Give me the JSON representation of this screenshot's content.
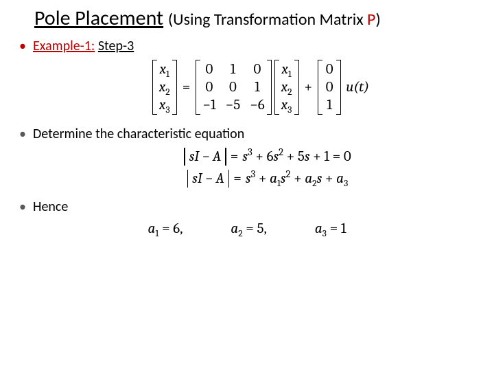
{
  "title": {
    "main": "Pole Placement",
    "sub_open": "(Using Transformation Matrix ",
    "p": "P",
    "sub_close": ")"
  },
  "bullet1": {
    "example": "Example-1:",
    "step": "Step-3"
  },
  "state_equation": {
    "x_vec": [
      "x",
      "x",
      "x"
    ],
    "x_sub": [
      "1",
      "2",
      "3"
    ],
    "A": [
      [
        "0",
        "1",
        "0"
      ],
      [
        "0",
        "0",
        "1"
      ],
      [
        "−1",
        "−5",
        "−6"
      ]
    ],
    "B": [
      "0",
      "0",
      "1"
    ],
    "eq": "=",
    "plus": "+",
    "u": "u(t)"
  },
  "bullet2": "Determine the characteristic equation",
  "char_eq": {
    "lhs_inner": "sI − A",
    "eq": "=",
    "rhs1_terms": {
      "s3": "s",
      "e3": "3",
      "p1": " + 6",
      "s2": "s",
      "e2": "2",
      "p2": " + 5",
      "s1": "s",
      "p3": " + 1 = 0"
    },
    "rhs2_terms": {
      "s3": "s",
      "e3": "3",
      "p1": " + ",
      "a1": "a",
      "a1s": "1",
      "s2": "s",
      "e2": "2",
      "p2": " + ",
      "a2": "a",
      "a2s": "2",
      "s1": "s",
      "p3": " + ",
      "a3": "a",
      "a3s": "3"
    }
  },
  "bullet3": "Hence",
  "coefficients": {
    "a1": {
      "sym": "a",
      "sub": "1",
      "eq": "= 6,",
      "comma": ""
    },
    "a2": {
      "sym": "a",
      "sub": "2",
      "eq": "= 5,",
      "comma": ""
    },
    "a3": {
      "sym": "a",
      "sub": "3",
      "eq": "= 1"
    }
  }
}
